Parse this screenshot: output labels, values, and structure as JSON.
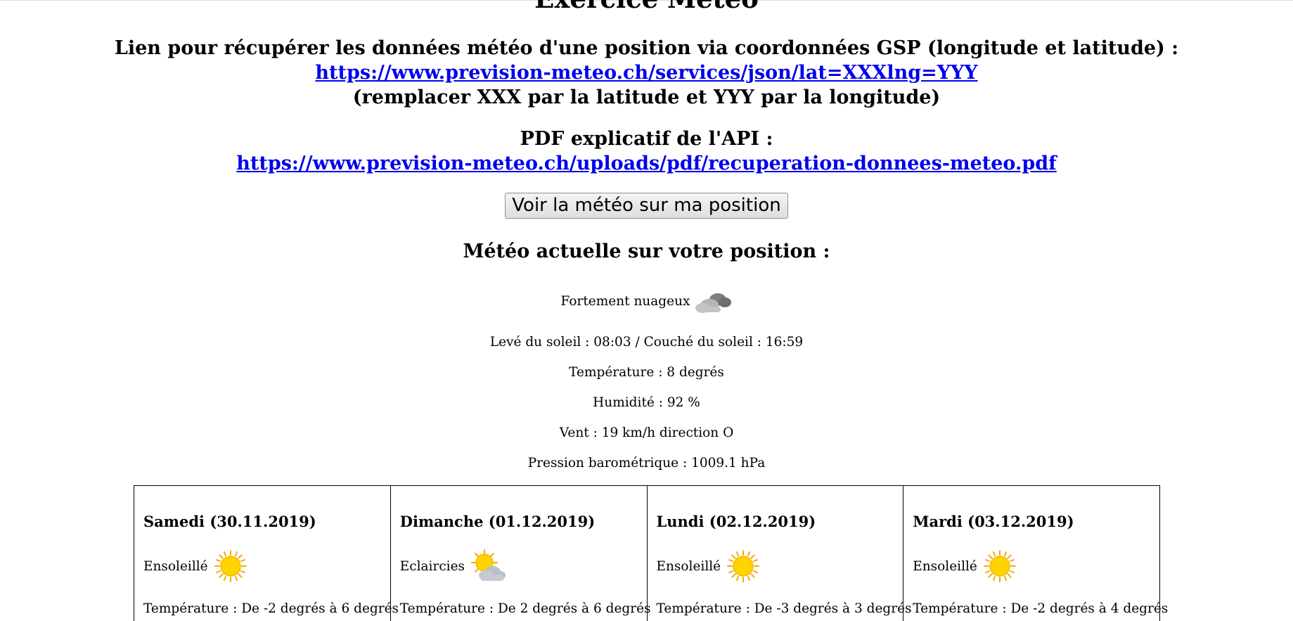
{
  "title": "Exercice Météo",
  "intro": {
    "line1": "Lien pour récupérer les données météo d'une position via coordonnées GSP (longitude et latitude) :",
    "link1": "https://www.prevision-meteo.ch/services/json/lat=XXXlng=YYY",
    "line3": "(remplacer XXX par la latitude et YYY par la longitude)",
    "pdf_label": "PDF explicatif de l'API :",
    "link2": "https://www.prevision-meteo.ch/uploads/pdf/recuperation-donnees-meteo.pdf"
  },
  "button_label": "Voir la météo sur ma position",
  "current": {
    "heading": "Météo actuelle sur votre position :",
    "condition": "Fortement nuageux",
    "condition_icon": "heavy-clouds-icon",
    "sun": "Levé du soleil : 08:03 / Couché du soleil : 16:59",
    "temperature": "Température : 8 degrés",
    "humidity": "Humidité : 92 %",
    "wind": "Vent : 19 km/h direction O",
    "pressure": "Pression barométrique : 1009.1 hPa"
  },
  "forecast": [
    {
      "title": "Samedi (30.11.2019)",
      "condition": "Ensoleillé",
      "icon": "sun-icon",
      "temp": "Température : De -2 degrés à 6 degrés"
    },
    {
      "title": "Dimanche (01.12.2019)",
      "condition": "Eclaircies",
      "icon": "sun-cloud-icon",
      "temp": "Température : De 2 degrés à 6 degrés"
    },
    {
      "title": "Lundi (02.12.2019)",
      "condition": "Ensoleillé",
      "icon": "sun-icon",
      "temp": "Température : De -3 degrés à 3 degrés"
    },
    {
      "title": "Mardi (03.12.2019)",
      "condition": "Ensoleillé",
      "icon": "sun-icon",
      "temp": "Température : De -2 degrés à 4 degrés"
    }
  ],
  "colors": {
    "link": "#0000ee",
    "sun": "#ffd200",
    "cloud": "#9a9a9a"
  }
}
